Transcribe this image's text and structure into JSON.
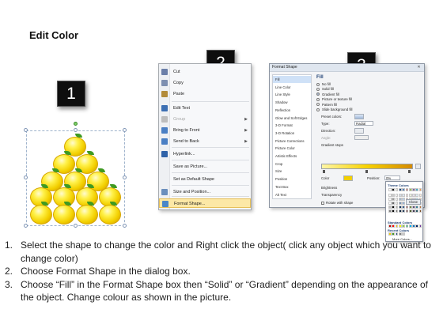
{
  "title": "Edit Color",
  "badges": [
    "1",
    "2",
    "3"
  ],
  "colors": {
    "apple": "#f3d000",
    "leaf": "#3f9a22",
    "menu_highlight": "#fce8a6",
    "dialog_accent": "#1d3f73"
  },
  "context_menu": {
    "items": [
      {
        "label": "Cut",
        "icon": "scissors-icon",
        "disabled": false,
        "submenu": false
      },
      {
        "label": "Copy",
        "icon": "copy-icon",
        "disabled": false,
        "submenu": false
      },
      {
        "label": "Paste",
        "icon": "paste-icon",
        "disabled": false,
        "submenu": false
      },
      {
        "label": "Edit Text",
        "icon": "edit-text-icon",
        "disabled": false,
        "submenu": false
      },
      {
        "label": "Group",
        "icon": "group-icon",
        "disabled": true,
        "submenu": true
      },
      {
        "label": "Bring to Front",
        "icon": "bring-to-front-icon",
        "disabled": false,
        "submenu": true
      },
      {
        "label": "Send to Back",
        "icon": "send-to-back-icon",
        "disabled": false,
        "submenu": true
      },
      {
        "label": "Hyperlink...",
        "icon": "hyperlink-icon",
        "disabled": false,
        "submenu": false
      },
      {
        "label": "Save as Picture...",
        "icon": "",
        "disabled": false,
        "submenu": false
      },
      {
        "label": "Set as Default Shape",
        "icon": "",
        "disabled": false,
        "submenu": false
      },
      {
        "label": "Size and Position...",
        "icon": "size-position-icon",
        "disabled": false,
        "submenu": false
      },
      {
        "label": "Format Shape...",
        "icon": "format-shape-icon",
        "disabled": false,
        "submenu": false,
        "highlighted": true
      }
    ]
  },
  "dialog": {
    "title": "Format Shape",
    "close_label": "Close",
    "nav": [
      "Fill",
      "Line Color",
      "Line Style",
      "Shadow",
      "Reflection",
      "Glow and Soft Edges",
      "3-D Format",
      "3-D Rotation",
      "Picture Corrections",
      "Picture Color",
      "Artistic Effects",
      "Crop",
      "Size",
      "Position",
      "Text Box",
      "Alt Text"
    ],
    "active_nav": "Fill",
    "fill": {
      "section_title": "Fill",
      "options": [
        {
          "label": "No fill",
          "selected": false
        },
        {
          "label": "Solid fill",
          "selected": false
        },
        {
          "label": "Gradient fill",
          "selected": true
        },
        {
          "label": "Picture or texture fill",
          "selected": false
        },
        {
          "label": "Pattern fill",
          "selected": false
        },
        {
          "label": "Slide background fill",
          "selected": false
        }
      ],
      "preset_colors_label": "Preset colors:",
      "type_label": "Type:",
      "type_value": "Radial",
      "direction_label": "Direction:",
      "angle_label": "Angle:",
      "gradient_stops_label": "Gradient stops",
      "color_label": "Color",
      "position_label": "Position:",
      "position_value": "0%",
      "brightness_label": "Brightness",
      "transparency_label": "Transparency",
      "rotate_label": "Rotate with shape"
    },
    "palette": {
      "theme_label": "Theme Colors",
      "standard_label": "Standard Colors",
      "recent_label": "Recent Colors",
      "more_label": "More Colors...",
      "theme_top": [
        "#ffffff",
        "#000000",
        "#eeece1",
        "#1f497d",
        "#4f81bd",
        "#c0504d",
        "#9bbb59",
        "#8064a2",
        "#4bacc6",
        "#f79646"
      ],
      "standard": [
        "#c00000",
        "#ff0000",
        "#ffc000",
        "#ffff00",
        "#92d050",
        "#00b050",
        "#00b0f0",
        "#0070c0",
        "#002060",
        "#7030a0"
      ],
      "recent": [
        "#f3d000",
        "#3f9a22",
        "#1f497d",
        "#7f7f7f",
        "#c9c9c9"
      ]
    }
  },
  "instructions": [
    {
      "num": "1.",
      "text": "Select the shape to change the color and Right click the object( click any object which you want to change color)"
    },
    {
      "num": "2.",
      "text": "Choose Format Shape in the dialog box."
    },
    {
      "num": "3.",
      "text": "Choose “Fill” in the Format Shape box then “Solid” or “Gradient” depending on the appearance of the object. Change colour as shown in the picture."
    }
  ]
}
